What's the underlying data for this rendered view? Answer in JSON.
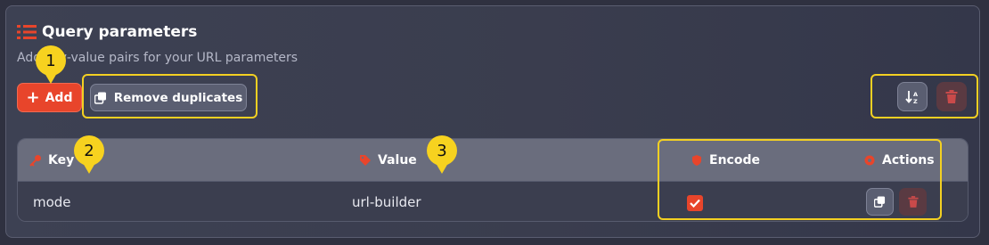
{
  "panel": {
    "title": "Query parameters",
    "subtitle": "Add key-value pairs for your URL parameters",
    "icon": "list-icon"
  },
  "toolbar": {
    "add_label": "Add",
    "remove_duplicates_label": "Remove duplicates",
    "sort_icon": "sort-az-icon",
    "delete_all_icon": "trash-icon"
  },
  "table": {
    "headers": {
      "key": "Key",
      "value": "Value",
      "encode": "Encode",
      "actions": "Actions"
    },
    "rows": [
      {
        "key": "mode",
        "value": "url-builder",
        "encode": true
      }
    ]
  },
  "annotations": [
    "1",
    "2",
    "3"
  ],
  "colors": {
    "accent": "#e8452b",
    "highlight": "#f3d022",
    "badge": "#f7d21f",
    "background": "#2f3140"
  }
}
